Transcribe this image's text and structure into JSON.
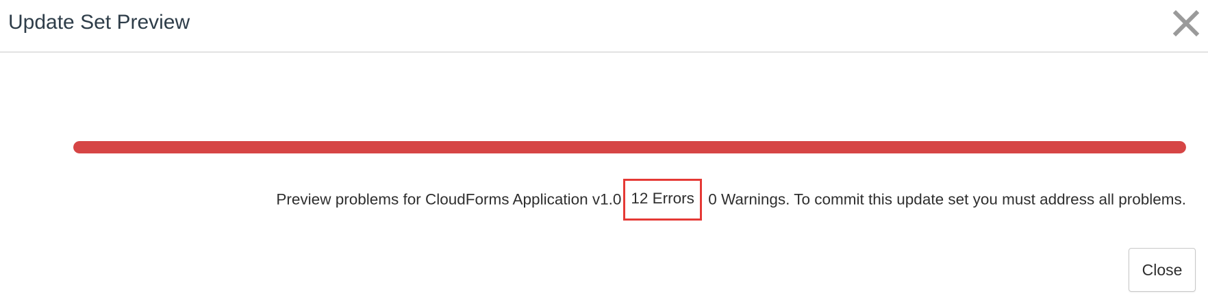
{
  "dialog": {
    "title": "Update Set Preview",
    "close_icon": "close-icon"
  },
  "progress": {
    "fraction": 1.0,
    "color": "#d64545"
  },
  "message": {
    "prefix": "Preview problems for CloudForms Application v1.0",
    "errors": "12 Errors",
    "suffix": "0 Warnings. To commit this update set you must address all problems."
  },
  "highlight_color": "#e53935",
  "footer": {
    "close_label": "Close"
  }
}
